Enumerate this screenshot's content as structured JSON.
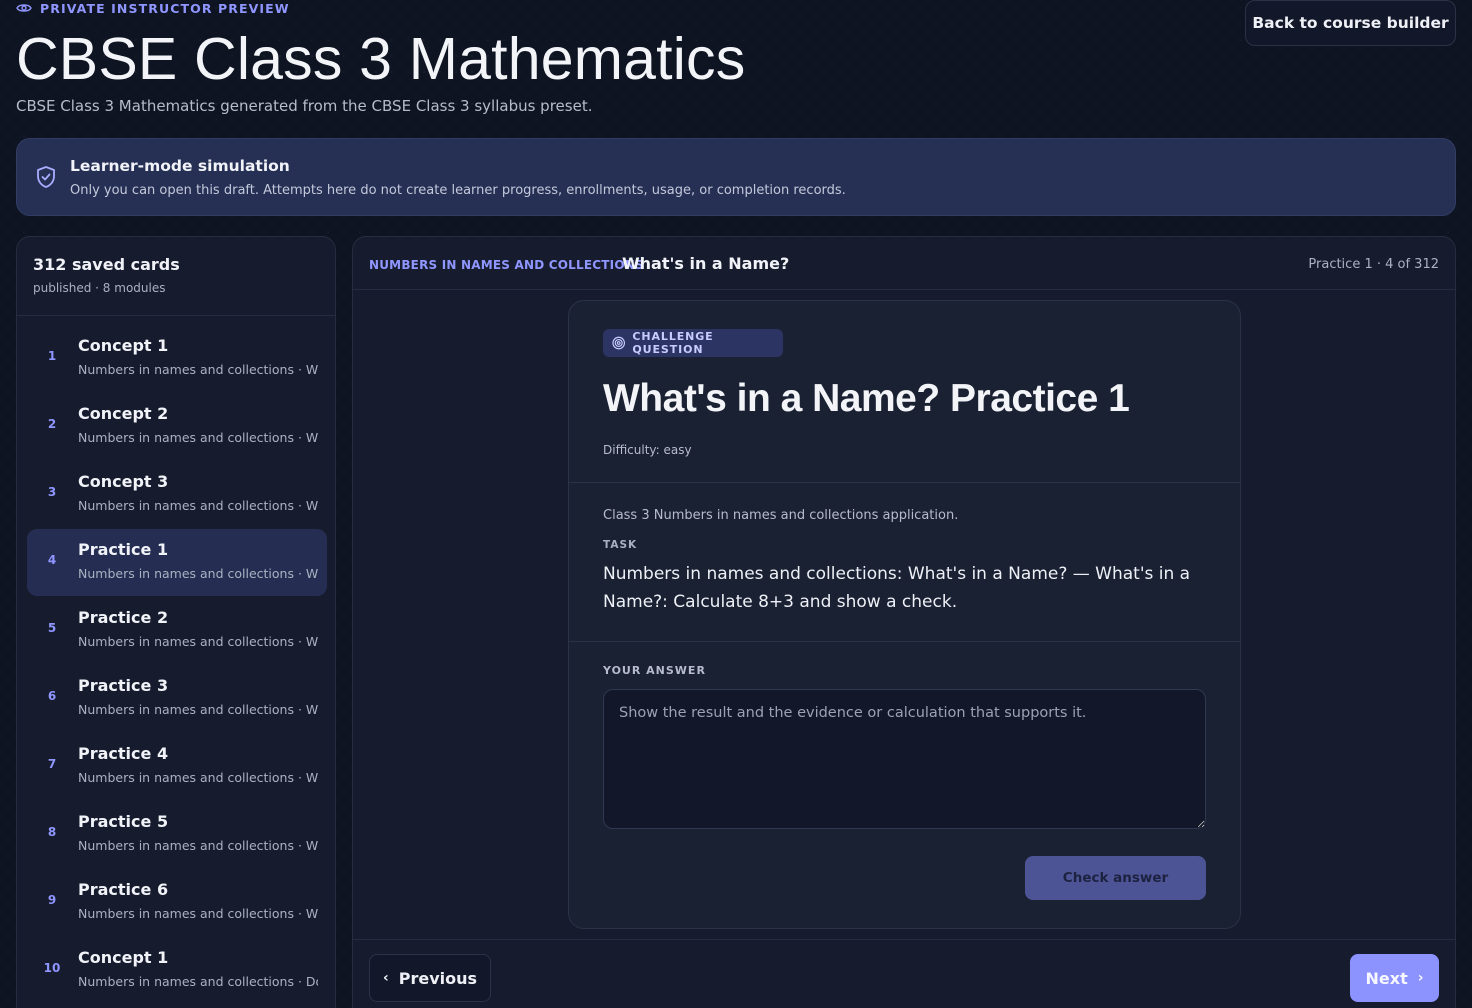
{
  "header": {
    "eyebrow": "PRIVATE INSTRUCTOR PREVIEW",
    "eyebrow_icon": "eye-icon",
    "title": "CBSE Class 3 Mathematics",
    "subtitle": "CBSE Class 3 Mathematics generated from the CBSE Class 3 syllabus preset.",
    "back_button": "Back to course builder"
  },
  "notice": {
    "icon": "shield-check-icon",
    "title": "Learner-mode simulation",
    "text": "Only you can open this draft. Attempts here do not create learner progress, enrollments, usage, or completion records."
  },
  "sidebar": {
    "count": "312 saved cards",
    "meta": "published · 8 modules",
    "items": [
      {
        "num": "1",
        "title": "Concept 1",
        "sub": "Numbers in names and collections · Wh..."
      },
      {
        "num": "2",
        "title": "Concept 2",
        "sub": "Numbers in names and collections · Wh..."
      },
      {
        "num": "3",
        "title": "Concept 3",
        "sub": "Numbers in names and collections · Wh..."
      },
      {
        "num": "4",
        "title": "Practice 1",
        "sub": "Numbers in names and collections · Wh..."
      },
      {
        "num": "5",
        "title": "Practice 2",
        "sub": "Numbers in names and collections · Wh..."
      },
      {
        "num": "6",
        "title": "Practice 3",
        "sub": "Numbers in names and collections · Wh..."
      },
      {
        "num": "7",
        "title": "Practice 4",
        "sub": "Numbers in names and collections · Wh..."
      },
      {
        "num": "8",
        "title": "Practice 5",
        "sub": "Numbers in names and collections · Wh..."
      },
      {
        "num": "9",
        "title": "Practice 6",
        "sub": "Numbers in names and collections · Wh..."
      },
      {
        "num": "10",
        "title": "Concept 1",
        "sub": "Numbers in names and collections · Do..."
      }
    ]
  },
  "main": {
    "module": "NUMBERS IN NAMES AND COLLECTIONS",
    "lesson": "What's in a Name?",
    "position": "Practice 1 · 4 of 312",
    "card": {
      "badge": "CHALLENGE QUESTION",
      "badge_icon": "target-icon",
      "title": "What's in a Name? Practice 1",
      "difficulty": "Difficulty: easy",
      "context": "Class 3 Numbers in names and collections application.",
      "task_label": "TASK",
      "task": "Numbers in names and collections: What's in a Name? — What's in a Name?: Calculate 8+3 and show a check.",
      "answer_label": "YOUR ANSWER",
      "answer_value": "",
      "answer_placeholder": "Show the result and the evidence or calculation that supports it.",
      "check_button": "Check answer"
    },
    "nav": {
      "previous": "Previous",
      "next": "Next"
    }
  }
}
